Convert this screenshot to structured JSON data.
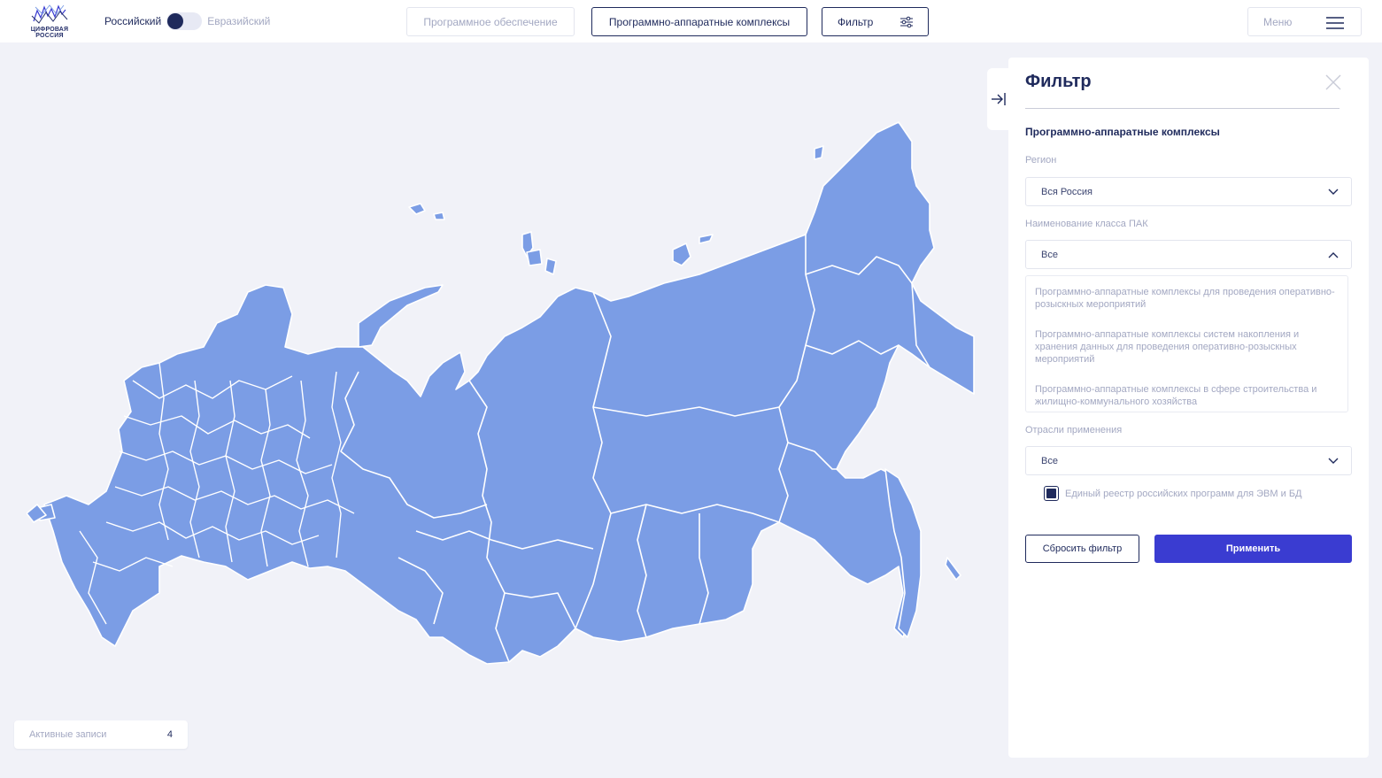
{
  "header": {
    "logo": {
      "line1": "ЦИФРОВАЯ",
      "line2": "РОССИЯ"
    },
    "switcher": {
      "option_left": "Российский",
      "option_right": "Евразийский",
      "active": "left"
    },
    "buttons": {
      "software": "Программное обеспечение",
      "pak": "Программно-аппаратные комплексы",
      "filter": "Фильтр",
      "menu": "Меню"
    }
  },
  "map": {
    "fill_color": "#7b9de5",
    "border_color": "#ffffff"
  },
  "filter_panel": {
    "title": "Фильтр",
    "section_title": "Программно-аппаратные комплексы",
    "region": {
      "label": "Регион",
      "value": "Вся Россия"
    },
    "pak_class": {
      "label": "Наименование класса ПАК",
      "value": "Все",
      "options": [
        "Программно-аппаратные комплексы для проведения оперативно-розыскных мероприятий",
        "Программно-аппаратные комплексы систем накопления и хранения данных для проведения оперативно-розыскных мероприятий",
        "Программно-аппаратные комплексы в сфере строительства и жилищно-коммунального хозяйства"
      ]
    },
    "industries": {
      "label": "Отрасли применения",
      "value": "Все"
    },
    "registry_checkbox": {
      "label": "Единый реестр российских программ для ЭВМ и БД",
      "checked": true
    },
    "reset_label": "Сбросить фильтр",
    "apply_label": "Применить"
  },
  "active_records": {
    "label": "Активные записи",
    "count": "4"
  },
  "colors": {
    "primary": "#3a3cd1",
    "dark": "#1f2a5c",
    "muted": "#a3a8c2"
  }
}
